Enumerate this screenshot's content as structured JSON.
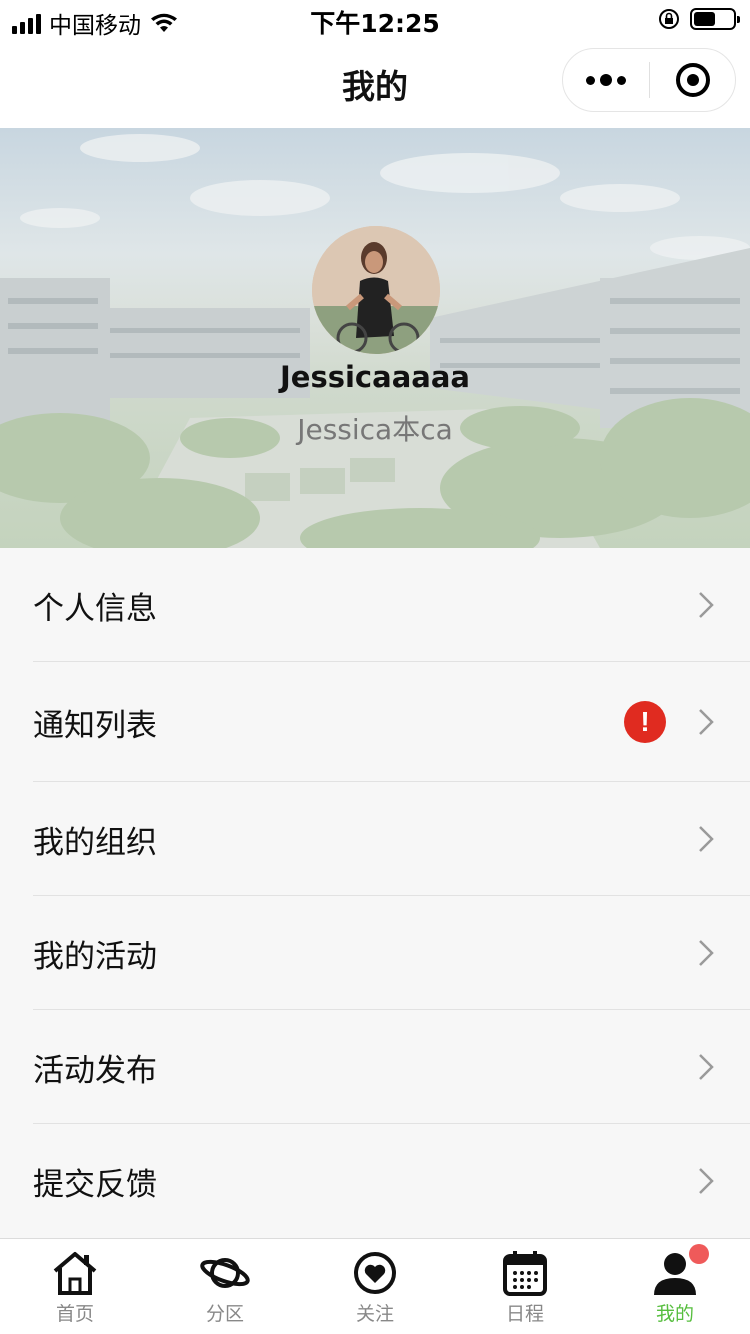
{
  "status_bar": {
    "carrier": "中国移动",
    "time": "下午12:25",
    "battery_level": 0.55
  },
  "nav": {
    "title": "我的"
  },
  "profile": {
    "username": "Jessicaaaaa",
    "nickname": "Jessica本ca"
  },
  "menu": {
    "items": [
      {
        "label": "个人信息",
        "alert": false
      },
      {
        "label": "通知列表",
        "alert": true,
        "alert_text": "!"
      },
      {
        "label": "我的组织",
        "alert": false
      },
      {
        "label": "我的活动",
        "alert": false
      },
      {
        "label": "活动发布",
        "alert": false
      },
      {
        "label": "提交反馈",
        "alert": false
      }
    ]
  },
  "tab_bar": {
    "active_tab": "我的",
    "active_color": "#57be3f",
    "tabs": [
      {
        "label": "首页",
        "icon": "home-icon"
      },
      {
        "label": "分区",
        "icon": "planet-icon"
      },
      {
        "label": "关注",
        "icon": "heart-icon"
      },
      {
        "label": "日程",
        "icon": "calendar-icon"
      },
      {
        "label": "我的",
        "icon": "user-icon",
        "notification_dot": true
      }
    ]
  }
}
